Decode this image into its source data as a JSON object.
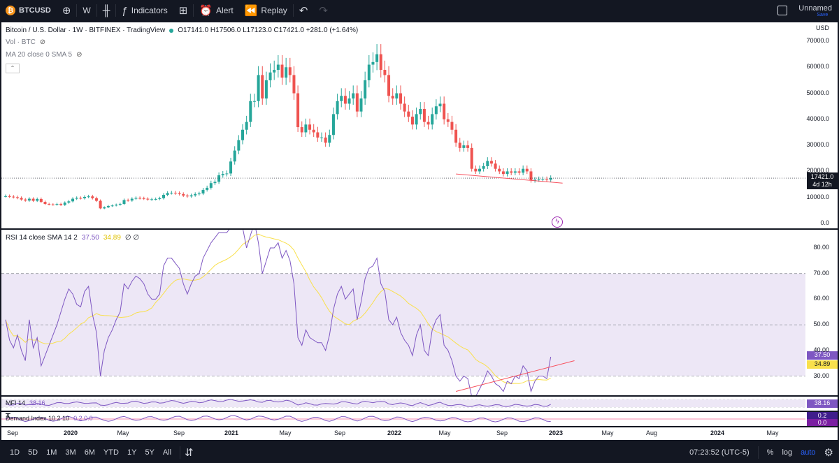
{
  "toolbar": {
    "symbol": "BTCUSD",
    "coin_glyph": "₿",
    "interval": "W",
    "indicators_label": "Indicators",
    "alert_label": "Alert",
    "replay_label": "Replay",
    "layout_name": "Unnamed",
    "save_label": "Save"
  },
  "main": {
    "title": "Bitcoin / U.S. Dollar · 1W · BITFINEX · TradingView",
    "ohlc": "O17141.0 H17506.0 L17123.0 C17421.0 +281.0 (+1.64%)",
    "vol_legend": "Vol · BTC",
    "ma_legend": "MA 20 close 0 SMA 5",
    "currency": "USD",
    "price_tag": "17421.0",
    "countdown": "4d 12h",
    "y_ticks": [
      "70000.0",
      "60000.0",
      "50000.0",
      "40000.0",
      "30000.0",
      "20000.0",
      "10000.0",
      "0.0"
    ]
  },
  "rsi": {
    "legend_name": "RSI 14 close SMA 14 2",
    "legend_v1": "37.50",
    "legend_v2": "34.89",
    "legend_v3": "∅ ∅",
    "tag1": "37.50",
    "tag2": "34.89",
    "y_ticks": [
      "80.00",
      "70.00",
      "60.00",
      "50.00",
      "40.00",
      "30.00"
    ]
  },
  "mfi": {
    "legend_name": "MFI 14",
    "legend_v": "38.16",
    "tag": "38.16"
  },
  "demand": {
    "legend_name": "Demand Index 10 2 10",
    "legend_v": "0.2  0.0",
    "tag1": "0.2",
    "tag2": "0.0"
  },
  "time_axis": [
    "Sep",
    "2020",
    "May",
    "Sep",
    "2021",
    "May",
    "Sep",
    "2022",
    "May",
    "Sep",
    "2023",
    "May",
    "Aug",
    "2024",
    "May"
  ],
  "bottom": {
    "ranges": [
      "1D",
      "5D",
      "1M",
      "3M",
      "6M",
      "YTD",
      "1Y",
      "5Y",
      "All"
    ],
    "clock": "07:23:52 (UTC-5)",
    "percent": "%",
    "log": "log",
    "auto": "auto"
  },
  "colors": {
    "up": "#26a69a",
    "down": "#ef5350",
    "rsi": "#7e57c2",
    "rsi_ma": "#f9e04b",
    "band": "#ede7f6",
    "trend": "#f7525f"
  },
  "chart_data": {
    "type": "candlestick",
    "x_range": [
      "2019-08",
      "2024-07"
    ],
    "y_range": [
      0,
      70000
    ],
    "close_weekly": [
      10500,
      10300,
      10100,
      9800,
      9200,
      8800,
      9500,
      8700,
      9400,
      8300,
      7500,
      7300,
      7200,
      7500,
      7100,
      8000,
      8500,
      9500,
      9800,
      9700,
      10200,
      10400,
      9700,
      8700,
      5800,
      6200,
      6700,
      6900,
      7200,
      7500,
      9000,
      8800,
      9500,
      9800,
      9700,
      9500,
      9200,
      9300,
      9400,
      9700,
      11000,
      11700,
      11800,
      11600,
      11300,
      10700,
      10400,
      10800,
      11300,
      11500,
      12900,
      13700,
      15500,
      16000,
      18500,
      19000,
      19200,
      23800,
      28000,
      32000,
      36000,
      39000,
      47000,
      47000,
      57000,
      48000,
      55000,
      58000,
      59000,
      61000,
      56000,
      60000,
      57000,
      50000,
      37000,
      35000,
      38000,
      36000,
      35000,
      33000,
      33000,
      31000,
      34000,
      42000,
      47000,
      49000,
      46000,
      48000,
      50000,
      43000,
      48000,
      55000,
      61000,
      62000,
      65000,
      59000,
      57000,
      49000,
      48000,
      50000,
      46000,
      43000,
      41000,
      38000,
      42000,
      44000,
      39000,
      38000,
      42000,
      45000,
      46000,
      40000,
      39000,
      36000,
      31000,
      29000,
      30000,
      29000,
      21000,
      20000,
      21000,
      22000,
      24000,
      23000,
      21000,
      20000,
      19000,
      20000,
      19500,
      20000,
      19500,
      21000,
      20000,
      16500,
      16800,
      17000,
      17000,
      16800,
      17421
    ],
    "rsi": [
      52,
      44,
      41,
      46,
      40,
      36,
      52,
      41,
      45,
      34,
      38,
      42,
      46,
      50,
      55,
      60,
      64,
      62,
      58,
      57,
      63,
      65,
      54,
      47,
      30,
      40,
      45,
      48,
      52,
      55,
      66,
      64,
      67,
      69,
      68,
      66,
      62,
      60,
      60,
      62,
      73,
      76,
      76,
      74,
      72,
      66,
      62,
      66,
      69,
      70,
      76,
      79,
      82,
      84,
      86,
      86,
      86,
      88,
      89,
      90,
      88,
      80,
      85,
      90,
      82,
      70,
      75,
      80,
      80,
      82,
      76,
      79,
      75,
      66,
      45,
      42,
      48,
      45,
      44,
      43,
      43,
      40,
      46,
      56,
      62,
      65,
      60,
      62,
      64,
      52,
      59,
      68,
      72,
      73,
      76,
      66,
      63,
      52,
      50,
      53,
      47,
      44,
      42,
      38,
      46,
      50,
      40,
      38,
      48,
      52,
      54,
      42,
      40,
      36,
      30,
      28,
      30,
      29,
      22,
      22,
      25,
      28,
      32,
      30,
      27,
      26,
      24,
      28,
      27,
      30,
      29,
      34,
      32,
      24,
      28,
      30,
      30,
      29,
      37.5
    ],
    "markers": {
      "last_close": 17421,
      "rsi_last": 37.5,
      "rsi_ma_last": 34.89,
      "mfi_last": 38.16,
      "demand_last": 0.2
    },
    "trendlines": [
      {
        "pane": "price",
        "from": [
          "2022-05",
          19000
        ],
        "to": [
          "2023-01",
          15500
        ]
      },
      {
        "pane": "rsi",
        "from": [
          "2022-06",
          25
        ],
        "to": [
          "2023-02",
          36
        ]
      }
    ]
  }
}
